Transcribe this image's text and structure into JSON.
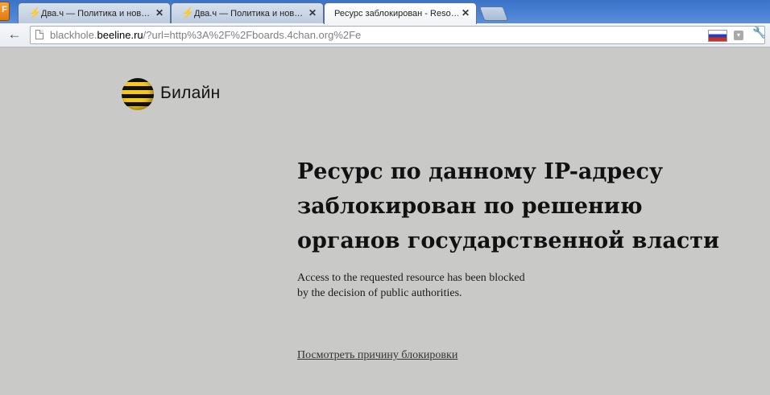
{
  "browser": {
    "app_button": "F",
    "tabs": [
      {
        "title": "Два.ч — Политика и нов…",
        "favicon": "lightning-icon",
        "close": "✕"
      },
      {
        "title": "Два.ч — Политика и нов…",
        "favicon": "lightning-icon",
        "close": "✕"
      },
      {
        "title": "Ресурс заблокирован - Reso…",
        "close": "✕",
        "active": true
      }
    ],
    "url_prefix": "blackhole.",
    "url_host": "beeline.ru",
    "url_rest": "/?url=http%3A%2F%2Fboards.4chan.org%2Fe",
    "back_glyph": "←",
    "menu_glyph": "▾",
    "wrench_glyph": "🔧"
  },
  "page": {
    "brand_name": "Билайн",
    "headline_lines": [
      "Ресурс по данному IP-адресу",
      "заблокирован по решению",
      "органов государственной власти"
    ],
    "subtext_lines": [
      "Access to the requested resource has been blocked",
      "by the decision of public authorities."
    ],
    "reason_link": "Посмотреть причину блокировки"
  },
  "colors": {
    "page_background": "#c9cac8",
    "tabstrip_blue": "#4a82d4",
    "beeline_yellow": "#f8c81a",
    "beeline_black": "#111111"
  }
}
